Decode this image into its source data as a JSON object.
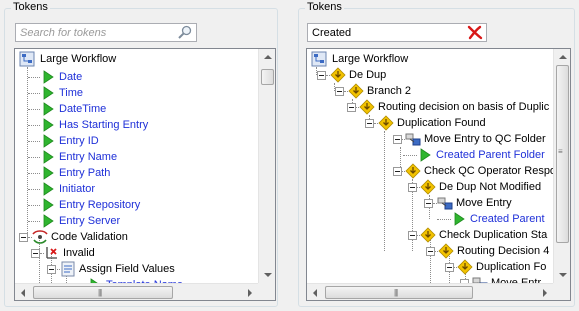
{
  "left_panel": {
    "title": "Tokens",
    "search_placeholder": "Search for tokens",
    "search_value": "",
    "root": "Large Workflow",
    "tokens": [
      "Date",
      "Time",
      "DateTime",
      "Has Starting Entry",
      "Entry ID",
      "Entry Name",
      "Entry Path",
      "Initiator",
      "Entry Repository",
      "Entry Server"
    ],
    "code_validation": "Code Validation",
    "invalid": "Invalid",
    "assign_field_values": "Assign Field Values",
    "template_name": "Template  Name"
  },
  "right_panel": {
    "title": "Tokens",
    "search_value": "Created",
    "root": "Large Workflow",
    "nodes": [
      "De Dup",
      "Branch 2",
      "Routing decision on basis of Duplic",
      "Duplication Found",
      "Move Entry to QC Folder",
      "Created Parent Folder",
      "Check QC Operator Respo",
      "De Dup Not Modified",
      "Move Entry",
      "Created Parent",
      "Check Duplication Sta",
      "Routing Decision 4",
      "Duplication Fo",
      "Move Entr"
    ]
  },
  "colors": {
    "token_text": "#1f30d8",
    "play_icon": "#2fb52f",
    "diamond_icon": "#f2c200",
    "clear_icon": "#d81818"
  },
  "icons": {
    "search": "magnifier-icon",
    "clear": "red-x-icon",
    "token": "green-play-icon",
    "branch": "yellow-diamond-icon",
    "workflow": "workflow-icon",
    "activity": "activity-icon"
  }
}
